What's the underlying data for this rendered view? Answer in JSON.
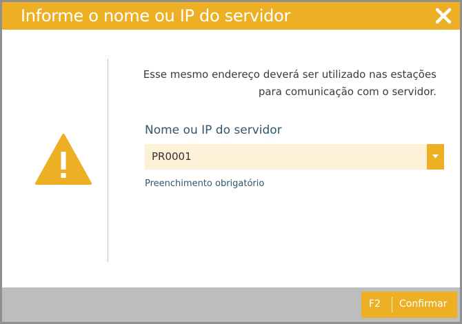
{
  "dialog": {
    "title": "Informe o nome ou IP do servidor",
    "close_icon": "close-icon",
    "warning_icon": "warning-icon",
    "message": "Esse mesmo endereço deverá ser utilizado nas estações para comunicação com o servidor.",
    "field": {
      "label": "Nome ou IP do servidor",
      "value": "PR0001",
      "dropdown_icon": "chevron-down-icon",
      "hint": "Preenchimento obrigatório"
    },
    "footer": {
      "confirm_key": "F2",
      "confirm_label": "Confirmar"
    }
  },
  "colors": {
    "accent": "#edb024",
    "input_background": "#fdf1d7",
    "label_text": "#2f556f",
    "footer_background": "#bdbdbd",
    "border": "#8f8f8f"
  }
}
